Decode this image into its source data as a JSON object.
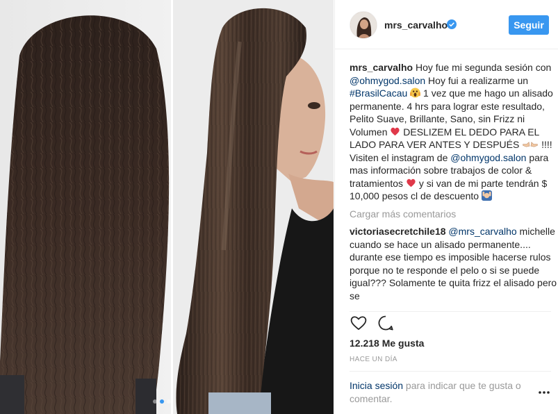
{
  "post": {
    "username": "mrs_carvalho",
    "verified_icon": "verified-badge-icon",
    "follow_label": "Seguir"
  },
  "caption": {
    "username": "mrs_carvalho",
    "text_1": " Hoy fue mi segunda sesión con ",
    "mention_1": "@ohmygod.salon",
    "text_2": " Hoy fui a realizarme un ",
    "hashtag": "#BrasilCacau",
    "text_3": " 1 vez que me hago un alisado permanente. 4 hrs para lograr este resultado, Pelito Suave, Brillante, Sano, sin Frizz ni Volumen ",
    "text_4": " DESLIZEM EL DEDO PARA EL LADO PARA VER ANTES Y DESPUÉS ",
    "text_5": " !!!! Visiten el instagram de ",
    "mention_2": "@ohmygod.salon",
    "text_6": " para mas información sobre trabajos de color & tratamientos ",
    "text_7": " y si van de mi parte tendrán $ 10,000 pesos cl de descuento "
  },
  "comments": {
    "load_more": "Cargar más comentarios",
    "items": [
      {
        "username": "victoriasecretchile18",
        "mention": "@mrs_carvalho",
        "text": " michelle cuando se hace un alisado permanente.... durante ese tiempo es imposible hacerse rulos porque no te responde el pelo o si se puede igual??? Solamente te quita frizz el alisado pero se"
      }
    ]
  },
  "actions": {
    "like_icon": "heart-icon",
    "comment_icon": "comment-bubble-icon"
  },
  "likes_text": "12.218 Me gusta",
  "timestamp": "HACE UN DÍA",
  "login_prompt": {
    "link": "Inicia sesión",
    "text": " para indicar que te gusta o comentar."
  },
  "more_icon": "more-options-icon",
  "carousel": {
    "slides": 3,
    "active": 2
  },
  "colors": {
    "accent": "#3897f0",
    "link": "#003569",
    "muted": "#999999",
    "text": "#262626"
  }
}
